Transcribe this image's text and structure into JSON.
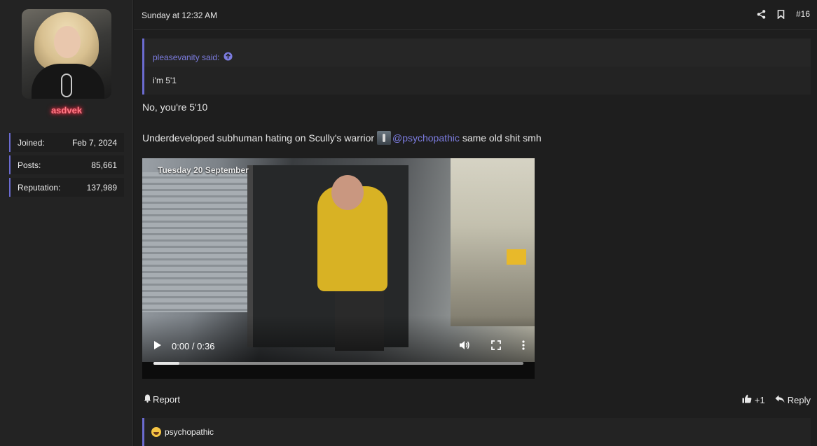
{
  "user": {
    "name": "asdvek",
    "stats": [
      {
        "label": "Joined:",
        "value": "Feb 7, 2024"
      },
      {
        "label": "Posts:",
        "value": "85,661"
      },
      {
        "label": "Reputation:",
        "value": "137,989"
      }
    ]
  },
  "post": {
    "date": "Sunday at 12:32 AM",
    "number": "#16",
    "quote": {
      "author": "pleasevanity said:",
      "text": "i'm 5'1"
    },
    "line1": "No, you're 5'10",
    "line2_before": "Underdeveloped subhuman hating on Scully's warrior",
    "mention": "@psychopathic",
    "line2_after": "same old shit smh"
  },
  "video": {
    "caption": "Tuesday 20 September",
    "time": "0:00 / 0:36",
    "progress": 0.07
  },
  "footer": {
    "report": "Report",
    "reaction_count": "+1",
    "reply": "Reply"
  },
  "reactions": {
    "user": "psychopathic"
  },
  "colors": {
    "accent": "#6b6bd0",
    "username_glow": "#ff2d46"
  }
}
